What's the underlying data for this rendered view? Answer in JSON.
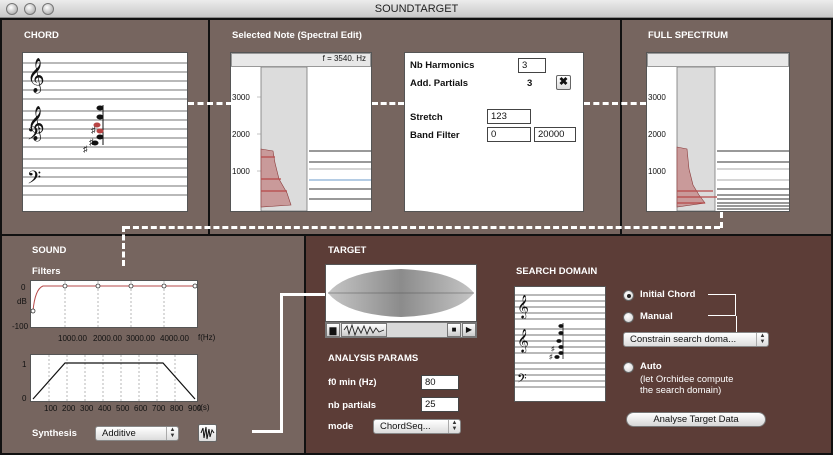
{
  "window": {
    "title": "SOUNDTARGET"
  },
  "chord": {
    "title": "CHORD"
  },
  "selected_note": {
    "title": "Selected Note (Spectral Edit)",
    "freq_readout": "f = 3540. Hz",
    "y_ticks": [
      "3000",
      "2000",
      "1000"
    ],
    "nb_harmonics_label": "Nb Harmonics",
    "nb_harmonics_value": "3",
    "add_partials_label": "Add. Partials",
    "add_partials_value": "3",
    "stretch_label": "Stretch",
    "stretch_value": "123",
    "band_filter_label": "Band Filter",
    "band_filter_low": "0",
    "band_filter_high": "20000"
  },
  "full_spectrum": {
    "title": "FULL SPECTRUM",
    "y_ticks": [
      "3000",
      "2000",
      "1000"
    ]
  },
  "sound": {
    "title": "SOUND",
    "filters_label": "Filters",
    "filter_y_ticks": [
      "0",
      "dB",
      "-100"
    ],
    "filter_x_ticks": [
      "1000.00",
      "2000.00",
      "3000.00",
      "4000.00"
    ],
    "filter_x_unit": "f(Hz)",
    "env_y_ticks": [
      "1",
      "0"
    ],
    "env_x_ticks": [
      "100",
      "200",
      "300",
      "400",
      "500",
      "600",
      "700",
      "800",
      "900"
    ],
    "env_x_unit": "t(s)",
    "synthesis_label": "Synthesis",
    "synthesis_value": "Additive"
  },
  "target": {
    "title": "TARGET",
    "analysis_title": "ANALYSIS PARAMS",
    "f0_label": "f0 min (Hz)",
    "f0_value": "80",
    "nb_partials_label": "nb partials",
    "nb_partials_value": "25",
    "mode_label": "mode",
    "mode_value": "ChordSeq...",
    "search_domain_title": "SEARCH DOMAIN",
    "initial_chord_label": "Initial Chord",
    "manual_label": "Manual",
    "constrain_value": "Constrain search doma...",
    "auto_label": "Auto",
    "auto_note_1": "(let Orchidee compute",
    "auto_note_2": "the search domain)",
    "analyse_button": "Analyse Target Data"
  }
}
